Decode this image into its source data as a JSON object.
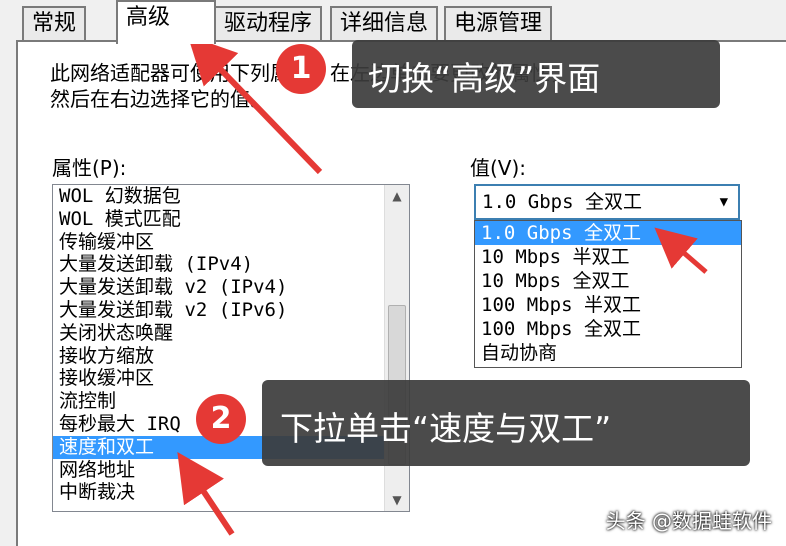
{
  "tabs": [
    "常规",
    "高级",
    "驱动程序",
    "详细信息",
    "电源管理"
  ],
  "description": {
    "line1": "此网络适配器可使用下列属性。在左边单击要更改的属性，",
    "line2": "然后在右边选择它的值。"
  },
  "properties": {
    "label": "属性(P):",
    "items": [
      "WOL 幻数据包",
      "WOL 模式匹配",
      "传输缓冲区",
      "大量发送卸载 (IPv4)",
      "大量发送卸载 v2 (IPv4)",
      "大量发送卸载 v2 (IPv6)",
      "关闭状态唤醒",
      "接收方缩放",
      "接收缓冲区",
      "流控制",
      "每秒最大 IRQ",
      "速度和双工",
      "网络地址",
      "中断裁决"
    ],
    "selected_index": 11
  },
  "value": {
    "label": "值(V):",
    "current": "1.0 Gbps 全双工",
    "options": [
      "1.0 Gbps 全双工",
      "10 Mbps 半双工",
      "10 Mbps 全双工",
      "100 Mbps 半双工",
      "100 Mbps 全双工",
      "自动协商"
    ],
    "selected_index": 0
  },
  "annotations": {
    "step1": {
      "number": "1",
      "text": "切换“高级”界面"
    },
    "step2": {
      "number": "2",
      "text": "下拉单击“速度与双工”"
    }
  },
  "watermark": "头条 @数据蛙软件",
  "colors": {
    "selection": "#3399ff",
    "badge": "#e53935",
    "arrow": "#e53935",
    "callout": "#3c3c3c"
  }
}
